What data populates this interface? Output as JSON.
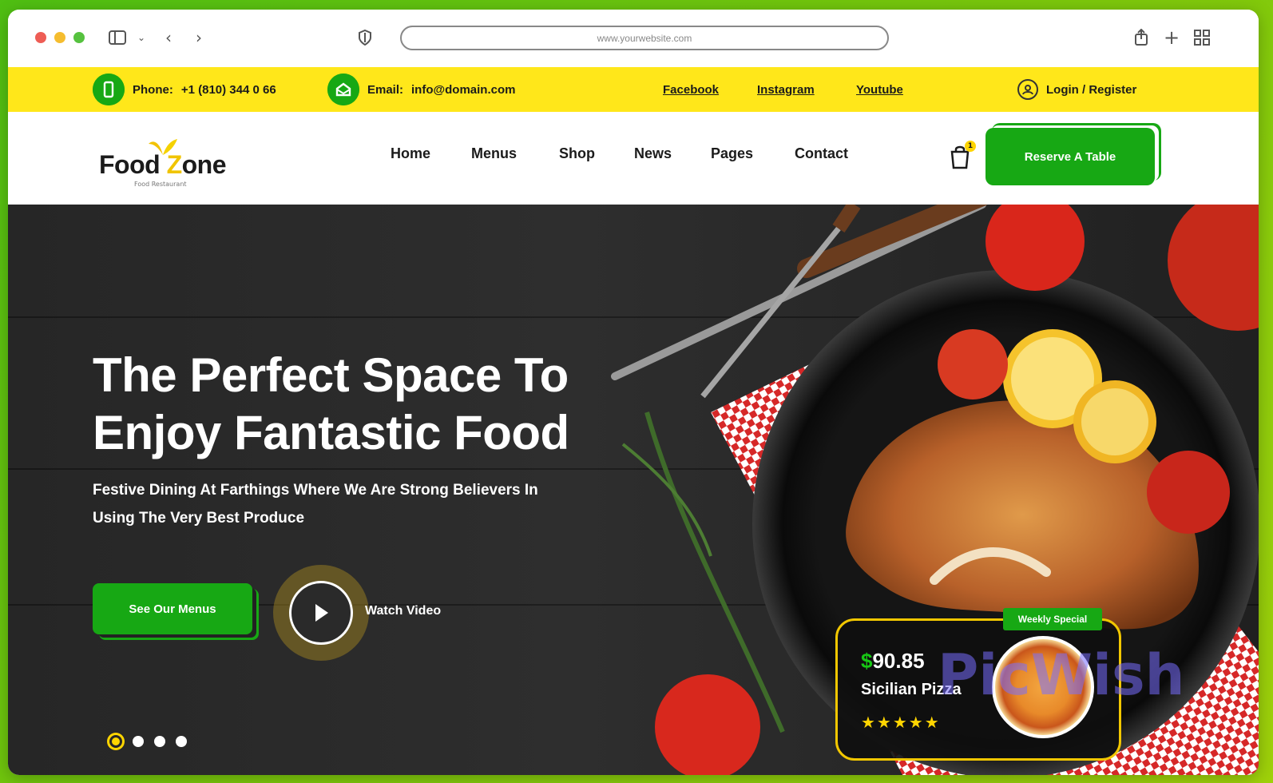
{
  "browser": {
    "url": "www.yourwebsite.com"
  },
  "topbar": {
    "phone_label": "Phone:",
    "phone_value": "+1 (810) 344 0 66",
    "email_label": "Email:",
    "email_value": "info@domain.com",
    "social": [
      "Facebook",
      "Instagram",
      "Youtube"
    ],
    "login": "Login / Register"
  },
  "nav": {
    "logo_main": "Food",
    "logo_z": "Z",
    "logo_end": "one",
    "logo_sub": "Food Restaurant",
    "links": [
      "Home",
      "Menus",
      "Shop",
      "News",
      "Pages",
      "Contact"
    ],
    "cart_count": "1",
    "reserve_label": "Reserve A Table"
  },
  "hero": {
    "title_line1": "The Perfect Space To",
    "title_line2": "Enjoy Fantastic Food",
    "subtitle_line1": "Festive Dining At Farthings Where We Are Strong Believers In",
    "subtitle_line2": "Using The Very Best Produce",
    "menu_button": "See Our Menus",
    "watch_label": "Watch Video",
    "slide_count": 4,
    "active_slide": 1
  },
  "special": {
    "tag": "Weekly Special",
    "price_symbol": "$",
    "price": "90.85",
    "name": "Sicilian Pizza",
    "stars": "★★★★★"
  },
  "watermark": "PicWish",
  "colors": {
    "accent_green": "#17a814",
    "accent_yellow": "#ffe71a",
    "hero_bg": "#262626"
  }
}
